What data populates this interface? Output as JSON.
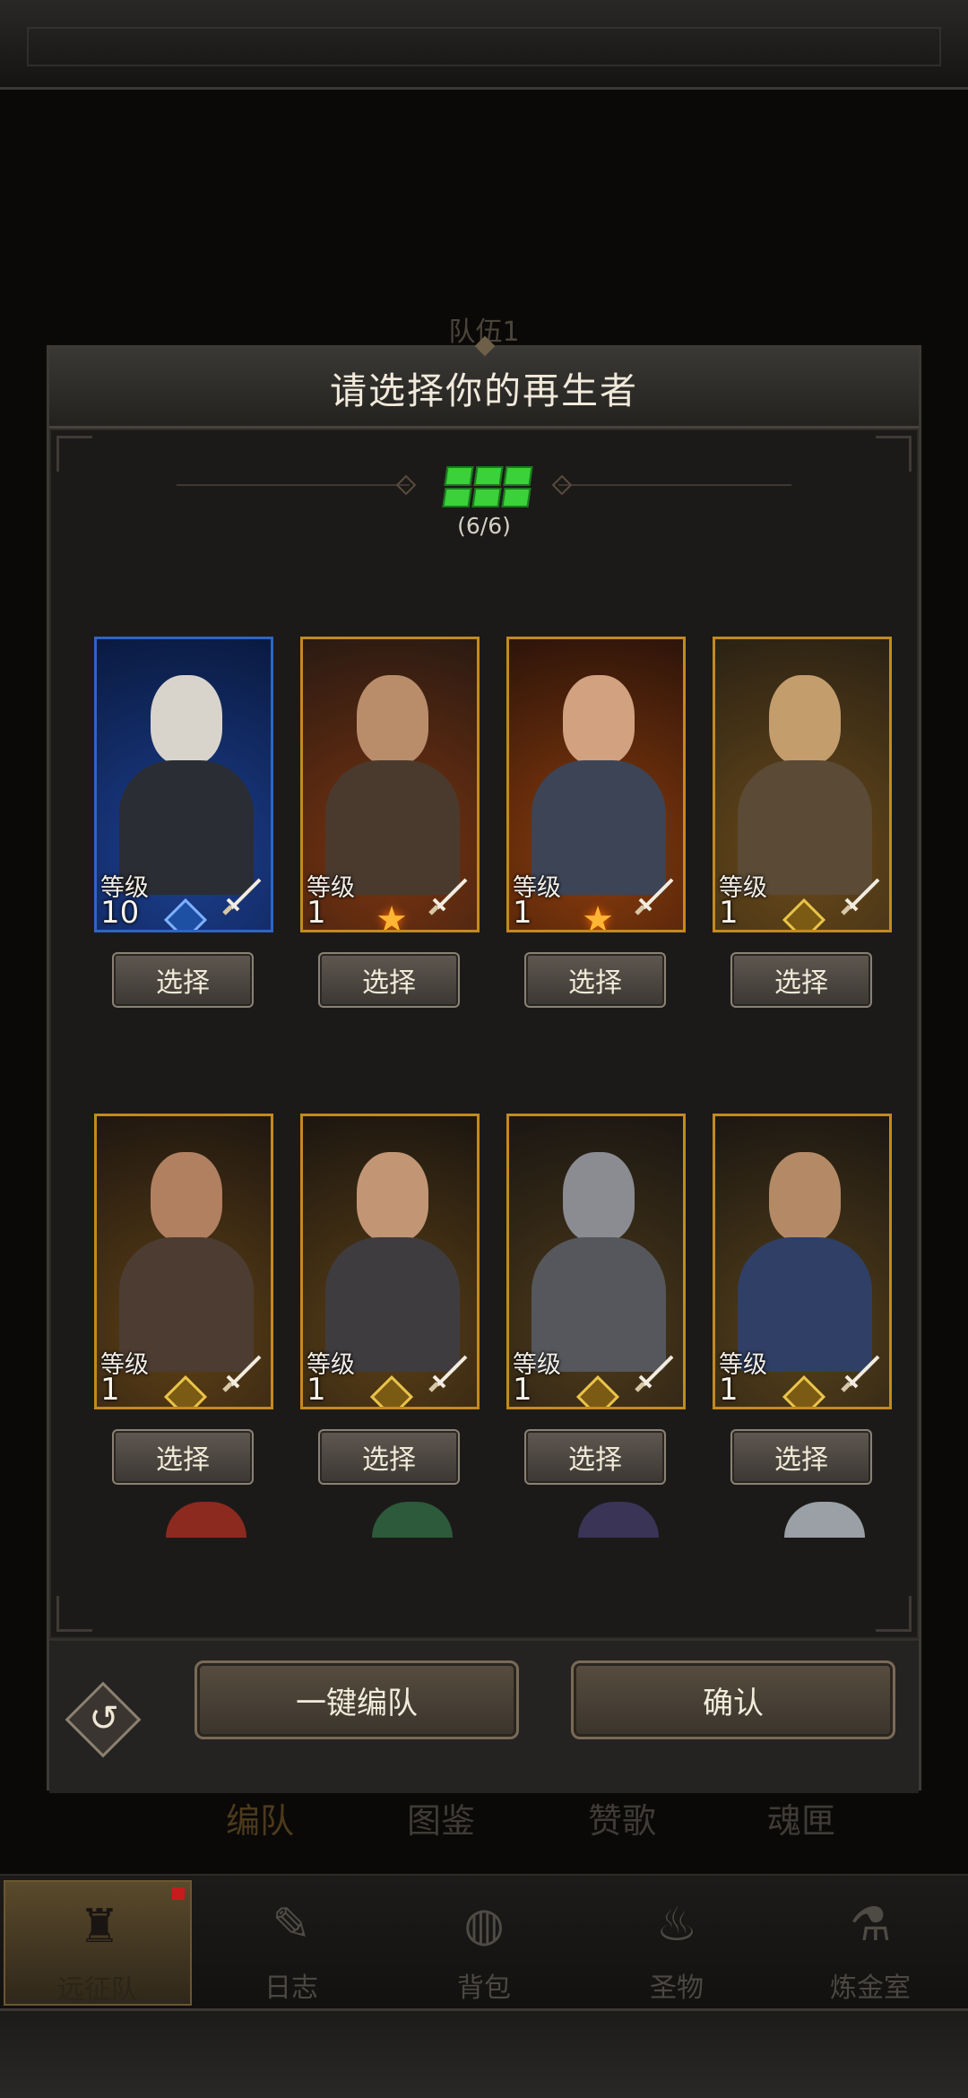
{
  "background": {
    "team_label": "队伍1",
    "tabs": [
      {
        "label": "编队",
        "active": true
      },
      {
        "label": "图鉴",
        "active": false
      },
      {
        "label": "赞歌",
        "active": false
      },
      {
        "label": "魂匣",
        "active": false
      }
    ]
  },
  "modal": {
    "title": "请选择你的再生者",
    "slots_text": "(6/6)",
    "level_label": "等级",
    "select_label": "选择",
    "heroes": [
      {
        "level": "10",
        "frame": "blue",
        "badge": "diamond"
      },
      {
        "level": "1",
        "frame": "gold",
        "badge": "star"
      },
      {
        "level": "1",
        "frame": "gold",
        "badge": "star"
      },
      {
        "level": "1",
        "frame": "gold",
        "badge": "diamond"
      },
      {
        "level": "1",
        "frame": "gold",
        "badge": "diamond"
      },
      {
        "level": "1",
        "frame": "gold",
        "badge": "diamond"
      },
      {
        "level": "1",
        "frame": "gold",
        "badge": "diamond"
      },
      {
        "level": "1",
        "frame": "gold",
        "badge": "diamond"
      }
    ],
    "auto_team_label": "一键编队",
    "confirm_label": "确认"
  },
  "bottom_nav": [
    {
      "label": "远征队",
      "icon": "helmet-icon",
      "active": true
    },
    {
      "label": "日志",
      "icon": "scroll-icon",
      "active": false
    },
    {
      "label": "背包",
      "icon": "bag-icon",
      "active": false
    },
    {
      "label": "圣物",
      "icon": "chalice-icon",
      "active": false
    },
    {
      "label": "炼金室",
      "icon": "alchemy-icon",
      "active": false
    }
  ],
  "colors": {
    "slot_green": "#3ad13a",
    "gold_frame": "#c48a1e",
    "blue_frame": "#2f64c4",
    "notification_red": "#c81b1b"
  }
}
